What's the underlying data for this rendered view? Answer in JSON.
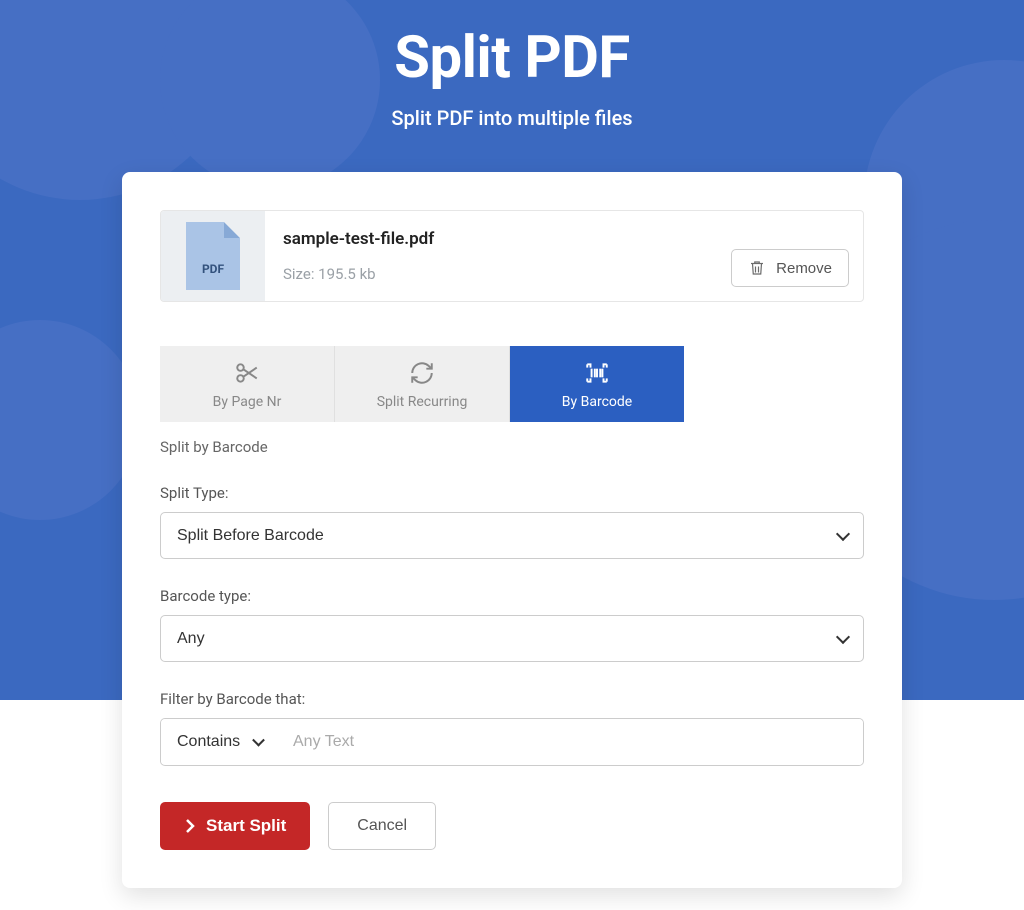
{
  "page": {
    "title": "Split PDF",
    "subtitle": "Split PDF into multiple files"
  },
  "file": {
    "icon_label": "PDF",
    "name": "sample-test-file.pdf",
    "size_label": "Size: 195.5 kb",
    "remove_label": "Remove"
  },
  "tabs": {
    "by_page": "By Page Nr",
    "recurring": "Split Recurring",
    "barcode": "By Barcode"
  },
  "section": {
    "heading": "Split by Barcode"
  },
  "fields": {
    "split_type_label": "Split Type:",
    "split_type_value": "Split Before Barcode",
    "barcode_type_label": "Barcode type:",
    "barcode_type_value": "Any",
    "filter_label": "Filter by Barcode that:",
    "filter_mode": "Contains",
    "filter_placeholder": "Any Text"
  },
  "actions": {
    "start": "Start Split",
    "cancel": "Cancel"
  }
}
